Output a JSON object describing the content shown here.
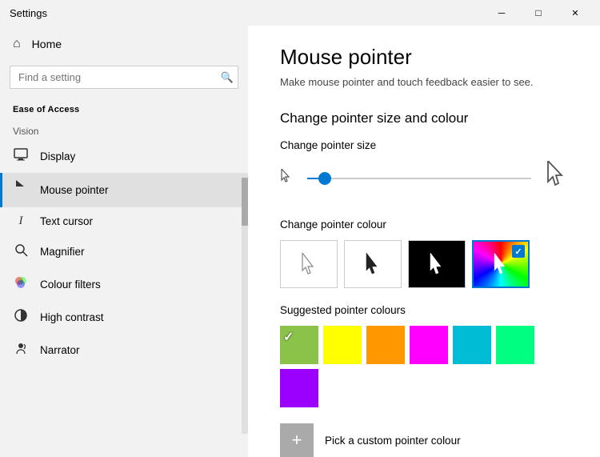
{
  "titleBar": {
    "title": "Settings",
    "minimizeLabel": "─",
    "maximizeLabel": "□",
    "closeLabel": "✕"
  },
  "sidebar": {
    "homeLabel": "Home",
    "searchPlaceholder": "Find a setting",
    "searchIcon": "🔍",
    "sectionLabel": "Ease of Access",
    "visionLabel": "Vision",
    "navItems": [
      {
        "id": "display",
        "icon": "🖥",
        "label": "Display"
      },
      {
        "id": "mouse-pointer",
        "icon": "🖱",
        "label": "Mouse pointer",
        "active": true
      },
      {
        "id": "text-cursor",
        "icon": "I",
        "label": "Text cursor"
      },
      {
        "id": "magnifier",
        "icon": "🔍",
        "label": "Magnifier"
      },
      {
        "id": "colour-filters",
        "icon": "🎨",
        "label": "Colour filters"
      },
      {
        "id": "high-contrast",
        "icon": "☀",
        "label": "High contrast"
      },
      {
        "id": "narrator",
        "icon": "💬",
        "label": "Narrator"
      }
    ]
  },
  "mainContent": {
    "pageTitle": "Mouse pointer",
    "pageSubtitle": "Make mouse pointer and touch feedback easier to see.",
    "sectionHeading": "Change pointer size and colour",
    "pointerSizeLabel": "Change pointer size",
    "sliderPercent": 8,
    "pointerColourLabel": "Change pointer colour",
    "colourOptions": [
      {
        "id": "white",
        "bg": "white",
        "cursor": "white"
      },
      {
        "id": "black",
        "bg": "white",
        "cursor": "black"
      },
      {
        "id": "blackbg",
        "bg": "black",
        "cursor": "white"
      },
      {
        "id": "custom",
        "bg": "rainbow",
        "cursor": "colored",
        "active": true
      }
    ],
    "suggestedLabel": "Suggested pointer colours",
    "suggestedColours": [
      {
        "hex": "#8BC34A",
        "selected": true
      },
      {
        "hex": "#FFFF00"
      },
      {
        "hex": "#FF9800"
      },
      {
        "hex": "#FF00FF"
      },
      {
        "hex": "#00BCD4"
      },
      {
        "hex": "#00FF80"
      },
      {
        "hex": "#9B00FF"
      }
    ],
    "customLabel": "Pick a custom pointer colour",
    "customBtnIcon": "+"
  }
}
